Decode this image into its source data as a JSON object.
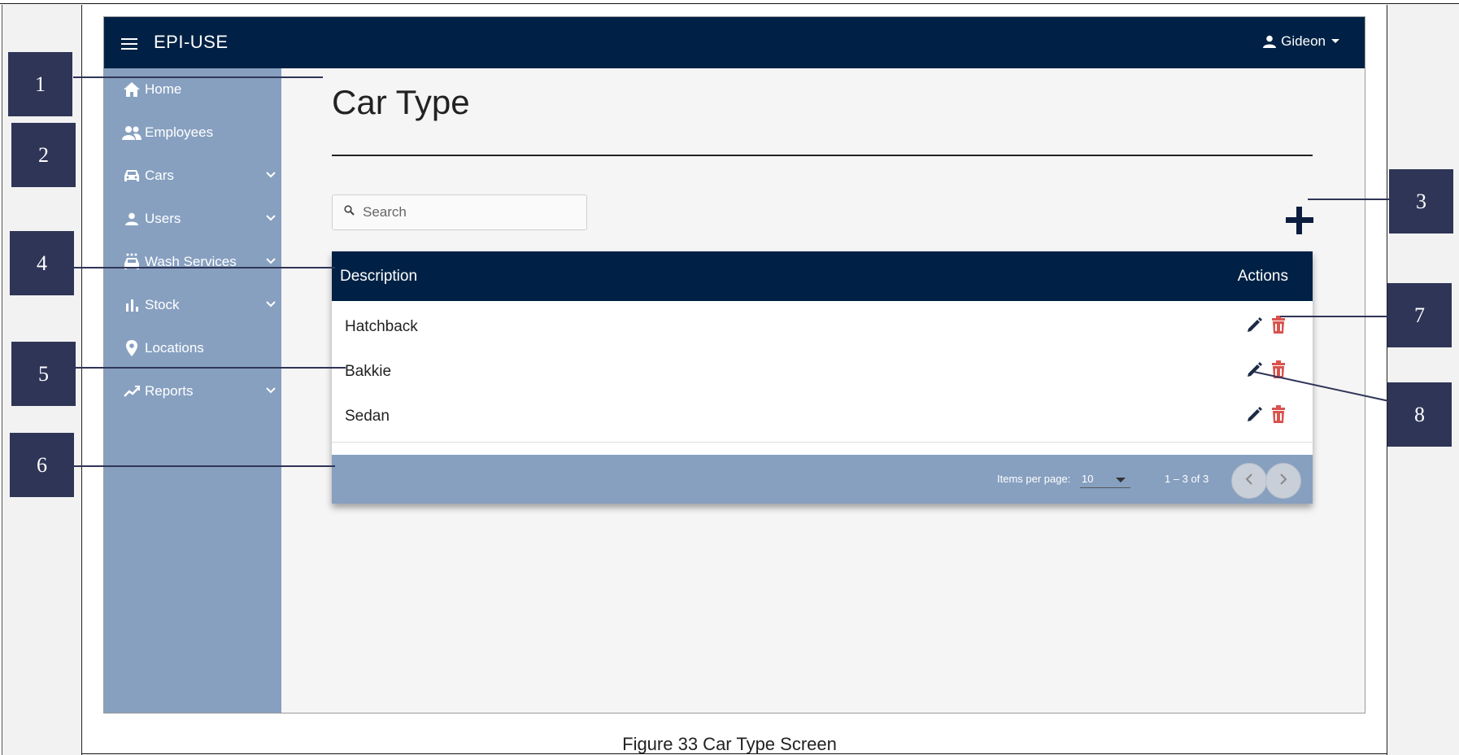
{
  "app": {
    "title": "EPI-USE",
    "user_name": "Gideon"
  },
  "sidebar": {
    "items": [
      {
        "label": "Home"
      },
      {
        "label": "Employees"
      },
      {
        "label": "Cars"
      },
      {
        "label": "Users"
      },
      {
        "label": "Wash Services"
      },
      {
        "label": "Stock"
      },
      {
        "label": "Locations"
      },
      {
        "label": "Reports"
      }
    ]
  },
  "page": {
    "title": "Car Type",
    "search_placeholder": "Search"
  },
  "table": {
    "columns": [
      "Description",
      "Actions"
    ],
    "rows": [
      "Hatchback",
      "Bakkie",
      "Sedan"
    ],
    "items_per_page_label": "Items per page:",
    "items_per_page_value": "10",
    "range_label": "1 – 3 of 3"
  },
  "callouts": [
    "1",
    "2",
    "3",
    "4",
    "5",
    "6",
    "7",
    "8"
  ],
  "caption": "Figure 33 Car Type Screen",
  "colors": {
    "topbar": "#002145",
    "sidebar": "#87a0c0",
    "delete": "#d9534f",
    "callout": "#2f3557"
  }
}
